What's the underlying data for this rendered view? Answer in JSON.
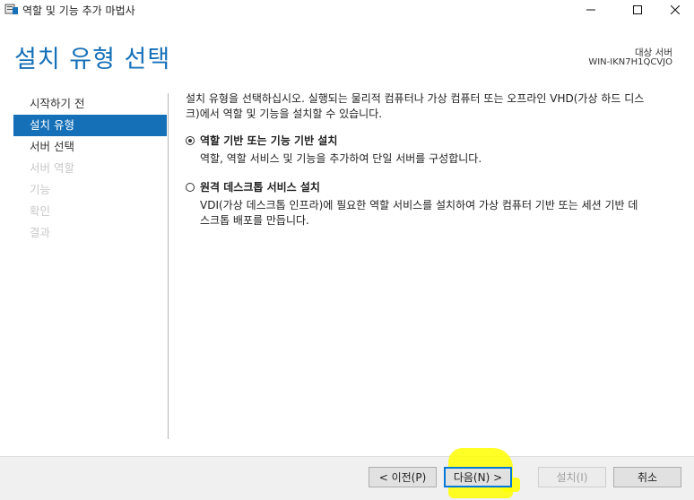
{
  "window": {
    "title": "역할 및 기능 추가 마법사",
    "controls": [
      "minimize-icon",
      "maximize-icon",
      "close-icon"
    ]
  },
  "header": {
    "page_title": "설치 유형 선택",
    "destination_label": "대상 서버",
    "destination_server": "WIN-IKN7H1QCVJO"
  },
  "sidebar": {
    "items": [
      {
        "label": "시작하기 전",
        "state": "normal"
      },
      {
        "label": "설치 유형",
        "state": "active"
      },
      {
        "label": "서버 선택",
        "state": "normal"
      },
      {
        "label": "서버 역할",
        "state": "disabled"
      },
      {
        "label": "기능",
        "state": "disabled"
      },
      {
        "label": "확인",
        "state": "disabled"
      },
      {
        "label": "결과",
        "state": "disabled"
      }
    ]
  },
  "main": {
    "description_line1": "설치 유형을 선택하십시오. 실행되는 물리적 컴퓨터나 가상 컴퓨터 또는 오프라인 VHD(가상 하드 디스",
    "description_line2": "크)에서 역할 및 기능을 설치할 수 있습니다.",
    "options": [
      {
        "label": "역할 기반 또는 기능 기반 설치",
        "desc_line1": "역할, 역할 서비스 및 기능을 추가하여 단일 서버를 구성합니다.",
        "desc_line2": "",
        "selected": true
      },
      {
        "label": "원격 데스크톱 서비스 설치",
        "desc_line1": "VDI(가상 데스크톱 인프라)에 필요한 역할 서비스를 설치하여 가상 컴퓨터 기반 또는 세션 기반 데",
        "desc_line2": "스크톱 배포를 만듭니다.",
        "selected": false
      }
    ]
  },
  "footer": {
    "prev_label": "< 이전(P)",
    "next_label": "다음(N) >",
    "install_label": "설치(I)",
    "cancel_label": "취소"
  },
  "colors": {
    "accent": "#1670b8",
    "highlight": "#ffff00"
  }
}
